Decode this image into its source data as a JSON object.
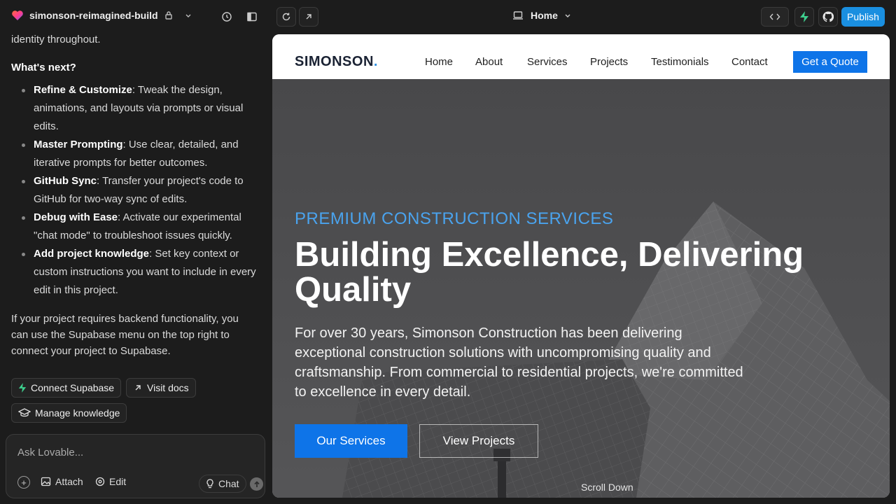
{
  "topbar": {
    "project_name": "simonson-reimagined-build",
    "route_label": "Home",
    "publish_label": "Publish"
  },
  "chat": {
    "intro_tail": "identity throughout.",
    "whats_next": "What's next?",
    "items": [
      {
        "title": "Refine & Customize",
        "text": ": Tweak the design, animations, and layouts via prompts or visual edits."
      },
      {
        "title": "Master Prompting",
        "text": ": Use clear, detailed, and iterative prompts for better outcomes."
      },
      {
        "title": "GitHub Sync",
        "text": ": Transfer your project's code to GitHub for two-way sync of edits."
      },
      {
        "title": "Debug with Ease",
        "text": ": Activate our experimental \"chat mode\" to troubleshoot issues quickly."
      },
      {
        "title": "Add project knowledge",
        "text": ": Set key context or custom instructions you want to include in every edit in this project."
      }
    ],
    "backend_note": "If your project requires backend functionality, you can use the Supabase menu on the top right to connect your project to Supabase.",
    "actions": {
      "connect_supabase": "Connect Supabase",
      "visit_docs": "Visit docs",
      "manage_knowledge": "Manage knowledge"
    },
    "input": {
      "placeholder": "Ask Lovable...",
      "attach": "Attach",
      "edit": "Edit",
      "chat": "Chat"
    }
  },
  "site": {
    "logo": "SIMONSON",
    "logo_dot": ".",
    "nav": [
      "Home",
      "About",
      "Services",
      "Projects",
      "Testimonials",
      "Contact"
    ],
    "cta": "Get a Quote",
    "hero": {
      "eyebrow": "PREMIUM CONSTRUCTION SERVICES",
      "headline": "Building Excellence, Delivering Quality",
      "lead": "For over 30 years, Simonson Construction has been delivering exceptional construction solutions with uncompromising quality and craftsmanship. From commercial to residential projects, we're committed to excellence in every detail.",
      "primary_btn": "Our Services",
      "secondary_btn": "View Projects",
      "scroll": "Scroll Down"
    }
  },
  "colors": {
    "accent": "#0e74e8",
    "eyebrow": "#4aa3ee",
    "publish": "#1a8fe0",
    "supabase": "#3ecf8e"
  }
}
